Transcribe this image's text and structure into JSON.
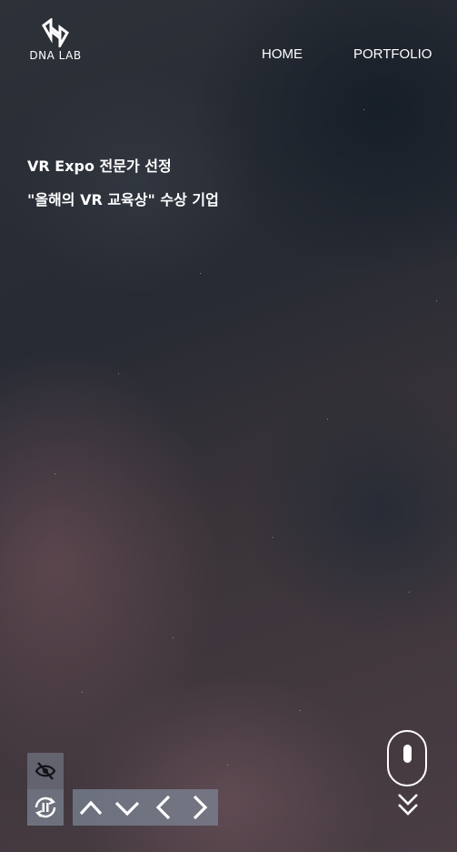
{
  "brand": {
    "logo_text": "DNA LAB",
    "logo_icon": "dna-lab-logo-icon"
  },
  "nav": {
    "items": [
      {
        "label": "HOME"
      },
      {
        "label": "PORTFOLIO"
      }
    ]
  },
  "hero": {
    "line1": "VR Expo 전문가 선정",
    "line2": "\"올해의 VR 교육상\" 수상 기업"
  },
  "controls": {
    "visibility_icon": "eye-off-icon",
    "pause_icon": "pause-rotate-icon",
    "arrows": [
      "chevron-up-icon",
      "chevron-down-icon",
      "chevron-left-icon",
      "chevron-right-icon"
    ],
    "scroll_icon": "mouse-icon",
    "scroll_down_icon": "double-chevron-down-icon"
  },
  "colors": {
    "text": "#ffffff",
    "control_bg": "#7d8796"
  }
}
